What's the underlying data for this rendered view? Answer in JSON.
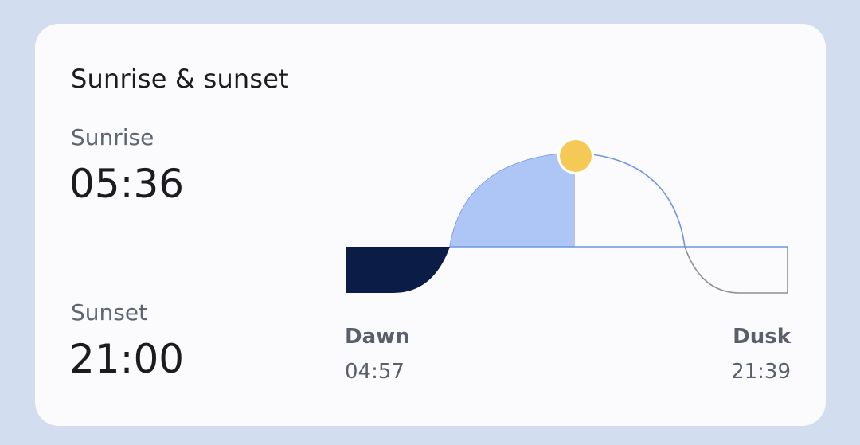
{
  "card": {
    "title": "Sunrise & sunset",
    "sunrise_label": "Sunrise",
    "sunrise_time": "05:36",
    "sunset_label": "Sunset",
    "sunset_time": "21:00",
    "dawn_label": "Dawn",
    "dawn_time": "04:57",
    "dusk_label": "Dusk",
    "dusk_time": "21:39"
  },
  "sun_icon": "sun-icon",
  "colors": {
    "page_background": "#d3ddf0",
    "card_background": "#fbfbfd",
    "night_fill": "#0b1c47",
    "daylight_fill": "#adc6f5",
    "arc_stroke": "#6e96e0",
    "twilight_stroke": "#8e8e93",
    "sun": "#f4c955"
  }
}
